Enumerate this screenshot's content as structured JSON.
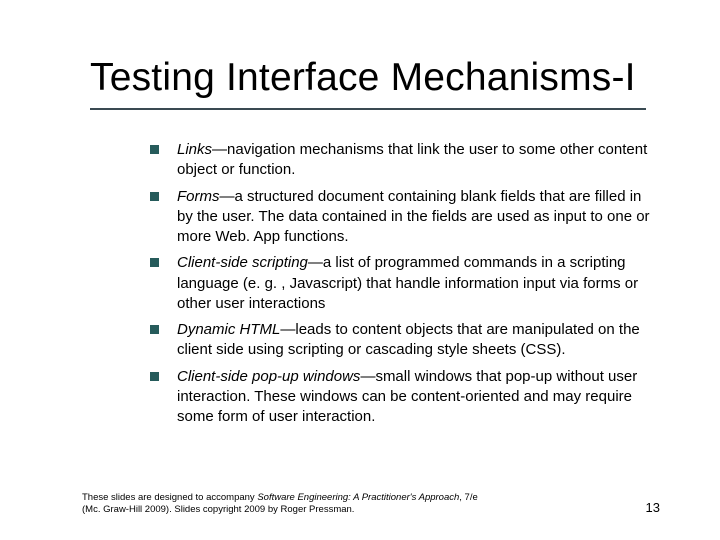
{
  "title": "Testing Interface Mechanisms-I",
  "bullets": [
    {
      "term": "Links",
      "desc": "—navigation mechanisms that link the user to some other content object or function."
    },
    {
      "term": "Forms",
      "desc": "—a structured document containing blank fields that are filled in by the user. The data contained in the fields are used as input to one or more Web. App functions."
    },
    {
      "term": "Client-side scripting",
      "desc": "—a list of programmed commands in a scripting language (e. g. , Javascript) that handle information input via forms or other user interactions"
    },
    {
      "term": "Dynamic HTML",
      "desc": "—leads to content objects that are manipulated on the client side using scripting or cascading style sheets (CSS)."
    },
    {
      "term": "Client-side pop-up windows",
      "desc": "—small windows that pop-up without user interaction. These windows can be content-oriented and may require some form of user interaction."
    }
  ],
  "footer": {
    "line1_pre": "These slides are designed to accompany ",
    "book": "Software Engineering: A Practitioner's Approach",
    "line1_post": ", 7/e",
    "line2": "(Mc. Graw-Hill 2009). Slides copyright 2009 by Roger Pressman."
  },
  "page": "13"
}
